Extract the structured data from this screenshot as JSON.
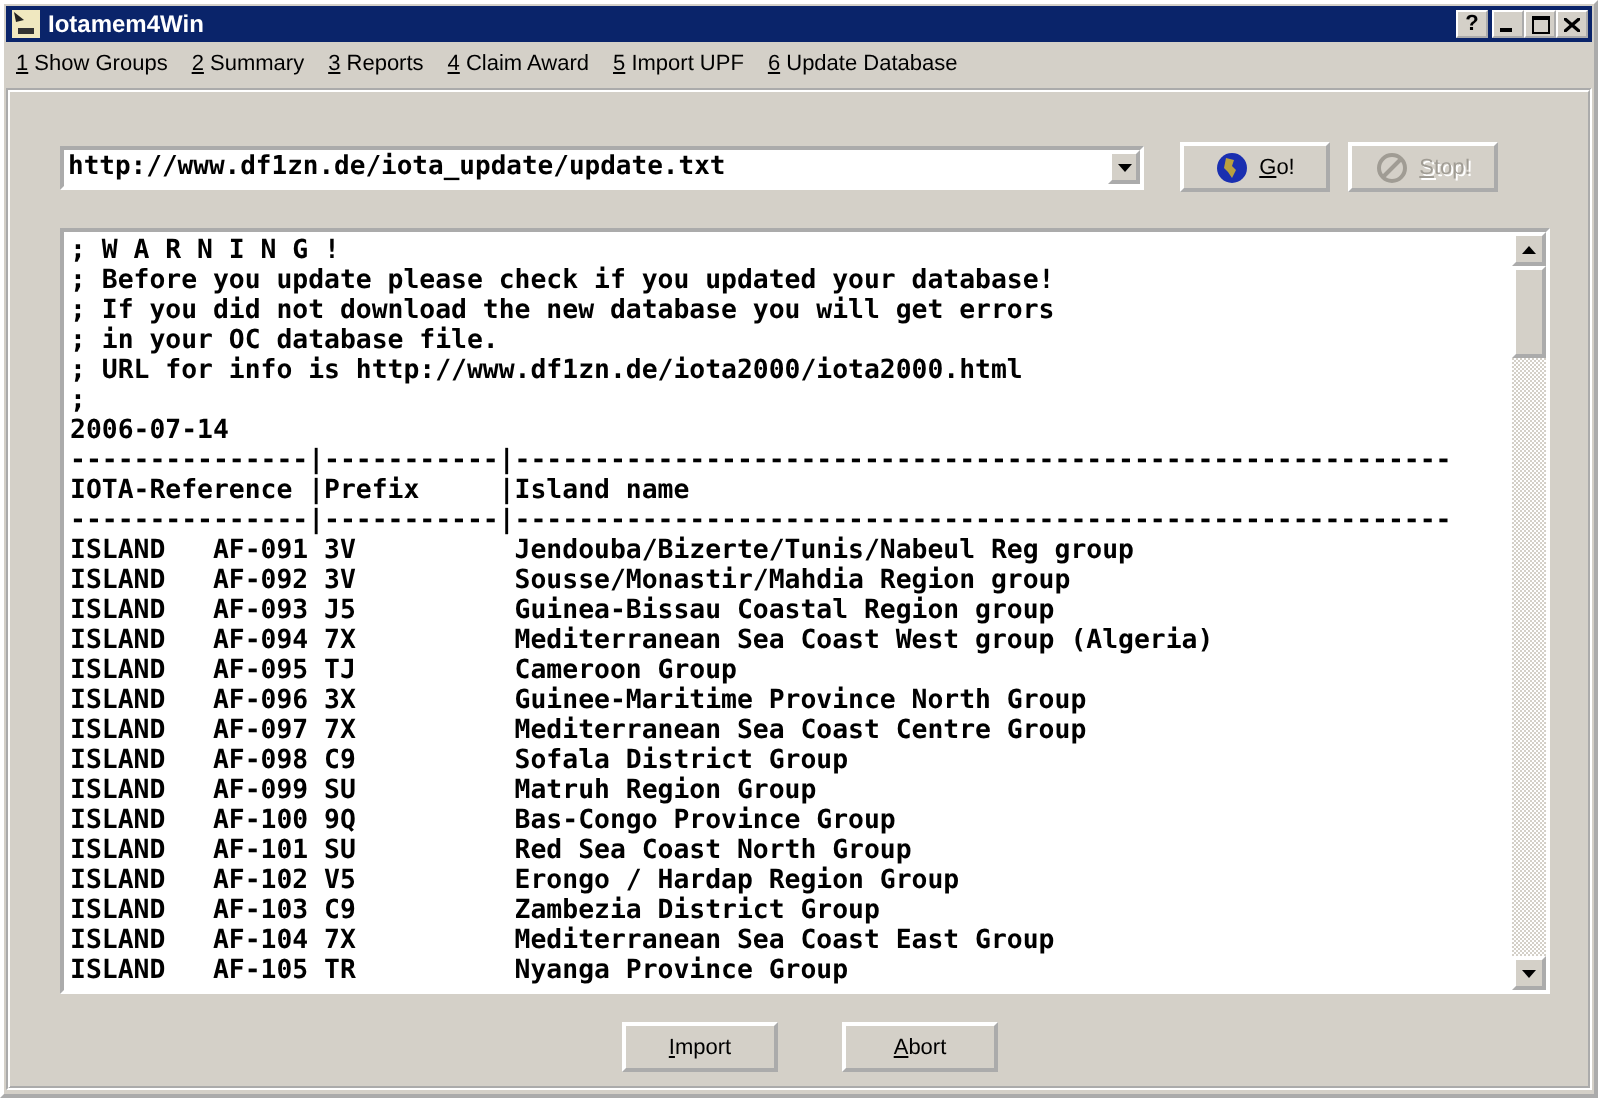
{
  "window": {
    "title": "Iotamem4Win",
    "help_button": "?"
  },
  "menu": [
    {
      "accel": "1",
      "label": " Show Groups"
    },
    {
      "accel": "2",
      "label": " Summary"
    },
    {
      "accel": "3",
      "label": " Reports"
    },
    {
      "accel": "4",
      "label": " Claim Award"
    },
    {
      "accel": "5",
      "label": " Import UPF"
    },
    {
      "accel": "6",
      "label": " Update Database"
    }
  ],
  "url_field": {
    "value": "http://www.df1zn.de/iota_update/update.txt"
  },
  "toolbar_buttons": [
    {
      "kind": "go",
      "accel": "G",
      "label": "o!",
      "disabled": false
    },
    {
      "kind": "stop",
      "accel": "S",
      "label": "top!",
      "disabled": true
    }
  ],
  "file_lines": [
    "; W A R N I N G !",
    "; Before you update please check if you updated your database!",
    "; If you did not download the new database you will get errors",
    "; in your OC database file.",
    "; URL for info is http://www.df1zn.de/iota2000/iota2000.html",
    ";",
    "2006-07-14",
    "---------------|-----------|-----------------------------------------------------------",
    "IOTA-Reference |Prefix     |Island name",
    "---------------|-----------|-----------------------------------------------------------",
    "ISLAND   AF-091 3V          Jendouba/Bizerte/Tunis/Nabeul Reg group",
    "ISLAND   AF-092 3V          Sousse/Monastir/Mahdia Region group",
    "ISLAND   AF-093 J5          Guinea-Bissau Coastal Region group",
    "ISLAND   AF-094 7X          Mediterranean Sea Coast West group (Algeria)",
    "ISLAND   AF-095 TJ          Cameroon Group",
    "ISLAND   AF-096 3X          Guinee-Maritime Province North Group",
    "ISLAND   AF-097 7X          Mediterranean Sea Coast Centre Group",
    "ISLAND   AF-098 C9          Sofala District Group",
    "ISLAND   AF-099 SU          Matruh Region Group",
    "ISLAND   AF-100 9Q          Bas-Congo Province Group",
    "ISLAND   AF-101 SU          Red Sea Coast North Group",
    "ISLAND   AF-102 V5          Erongo / Hardap Region Group",
    "ISLAND   AF-103 C9          Zambezia District Group",
    "ISLAND   AF-104 7X          Mediterranean Sea Coast East Group",
    "ISLAND   AF-105 TR          Nyanga Province Group"
  ],
  "bottom_buttons": [
    {
      "accel": "I",
      "label": "mport"
    },
    {
      "accel": "A",
      "label": "bort"
    }
  ]
}
